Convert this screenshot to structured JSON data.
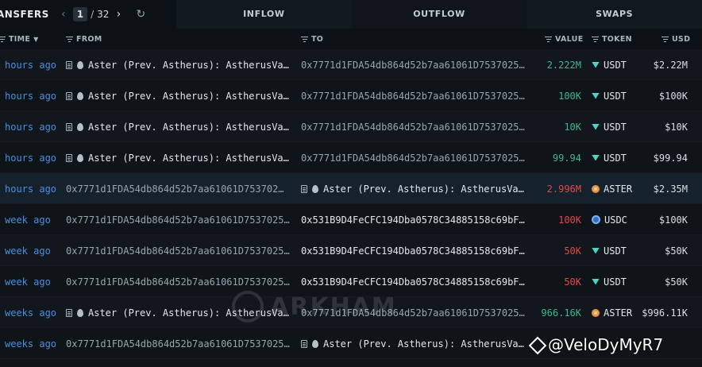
{
  "header": {
    "section_title": "ANSFERS",
    "page_current": "1",
    "page_separator": "/",
    "page_total": "32",
    "tabs": [
      {
        "label": "INFLOW"
      },
      {
        "label": "OUTFLOW"
      },
      {
        "label": "SWAPS"
      }
    ]
  },
  "columns": {
    "time": "TIME",
    "from": "FROM",
    "to": "TO",
    "value": "VALUE",
    "token": "TOKEN",
    "usd": "USD"
  },
  "rows": [
    {
      "time": "hours ago",
      "from": "Aster (Prev. Astherus): AstherusVa…",
      "to": "0x7771d1FDA54db864d52b7aa61061D7537025…",
      "value": "2.222M",
      "token": "USDT",
      "usd": "$2.22M"
    },
    {
      "time": "hours ago",
      "from": "Aster (Prev. Astherus): AstherusVa…",
      "to": "0x7771d1FDA54db864d52b7aa61061D7537025…",
      "value": "100K",
      "token": "USDT",
      "usd": "$100K"
    },
    {
      "time": "hours ago",
      "from": "Aster (Prev. Astherus): AstherusVa…",
      "to": "0x7771d1FDA54db864d52b7aa61061D7537025…",
      "value": "10K",
      "token": "USDT",
      "usd": "$10K"
    },
    {
      "time": "hours ago",
      "from": "Aster (Prev. Astherus): AstherusVa…",
      "to": "0x7771d1FDA54db864d52b7aa61061D7537025…",
      "value": "99.94",
      "token": "USDT",
      "usd": "$99.94"
    },
    {
      "time": "hours ago",
      "from": "0x7771d1FDA54db864d52b7aa61061D753702…",
      "to": "Aster (Prev. Astherus): AstherusVa…",
      "value": "2.996M",
      "token": "ASTER",
      "usd": "$2.35M"
    },
    {
      "time": "week ago",
      "from": "0x7771d1FDA54db864d52b7aa61061D7537025…",
      "to": "0x531B9D4FeCFC194Dba0578C34885158c69bF…",
      "value": "100K",
      "token": "USDC",
      "usd": "$100K"
    },
    {
      "time": "week ago",
      "from": "0x7771d1FDA54db864d52b7aa61061D7537025…",
      "to": "0x531B9D4FeCFC194Dba0578C34885158c69bF…",
      "value": "50K",
      "token": "USDT",
      "usd": "$50K"
    },
    {
      "time": "week ago",
      "from": "0x7771d1FDA54db864d52b7aa61061D7537025…",
      "to": "0x531B9D4FeCFC194Dba0578C34885158c69bF…",
      "value": "50K",
      "token": "USDT",
      "usd": "$50K"
    },
    {
      "time": "weeks ago",
      "from": "Aster (Prev. Astherus): AstherusVa…",
      "to": "0x7771d1FDA54db864d52b7aa61061D7537025…",
      "value": "966.16K",
      "token": "ASTER",
      "usd": "$996.11K"
    },
    {
      "time": "weeks ago",
      "from": "0x7771d1FDA54db864d52b7aa61061D7537025…",
      "to": "Aster (Prev. Astherus): AstherusVa…",
      "value": "",
      "token": "",
      "usd": ""
    }
  ],
  "overlays": {
    "watermark": "ARKHAM",
    "brand": "@VeloDyMyR7"
  },
  "colors": {
    "background": "#0f1419",
    "inflow_value": "#3fb68b",
    "outflow_value": "#e04848",
    "time_link": "#4a8fe0",
    "highlight_row": "#16212e"
  }
}
